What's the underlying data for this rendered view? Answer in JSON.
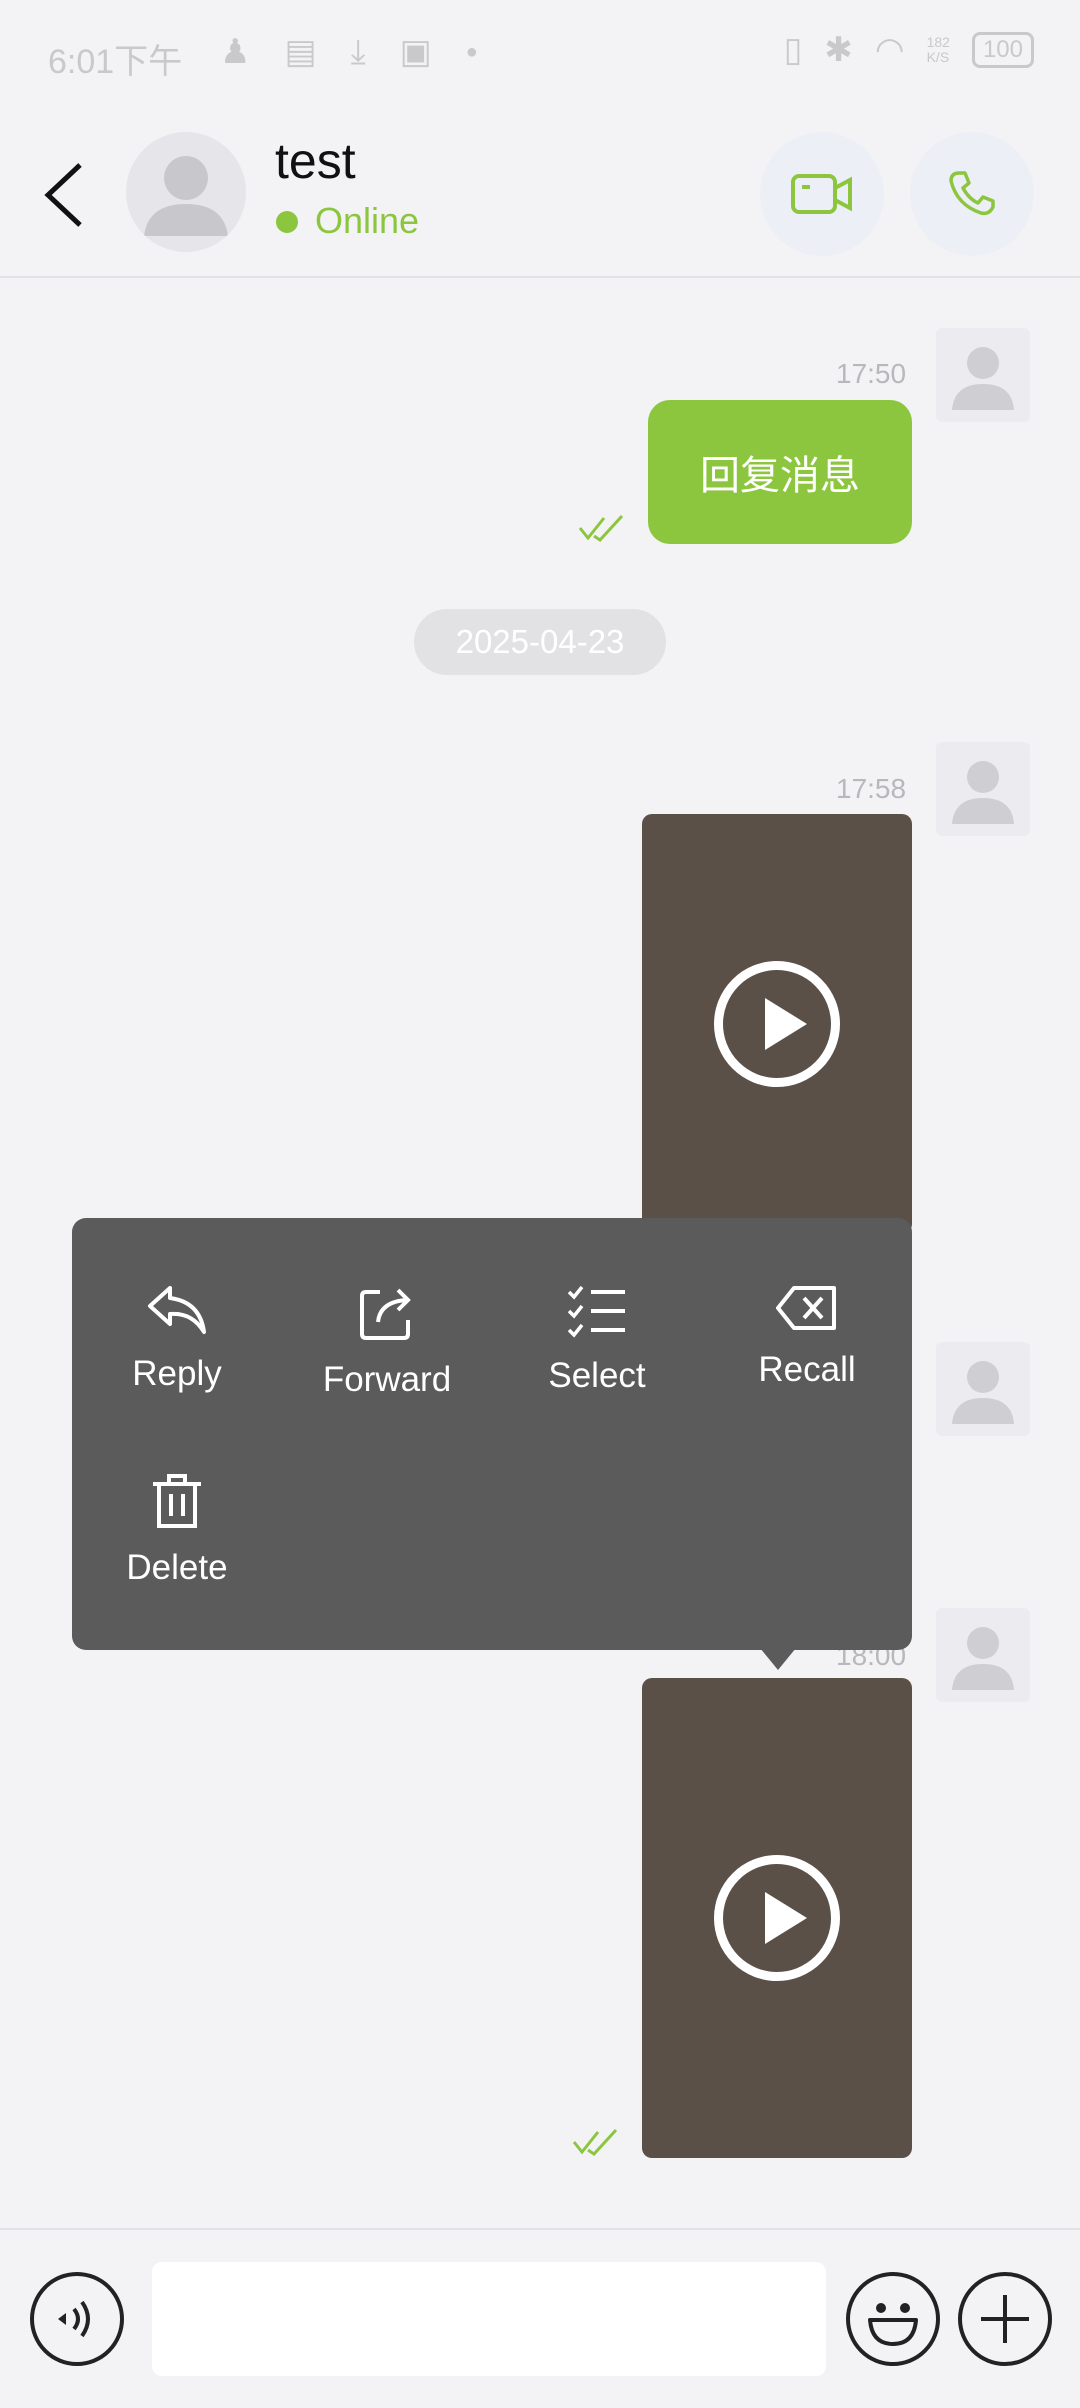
{
  "status_bar": {
    "time": "6:01下午",
    "net_speed": "182\nK/S",
    "battery": "100"
  },
  "header": {
    "title": "test",
    "status": "Online"
  },
  "messages": {
    "msg1": {
      "time": "17:50",
      "text": "回复消息"
    },
    "date_divider": "2025-04-23",
    "msg2": {
      "time": "17:58"
    },
    "msg3": {
      "time": "18:00"
    }
  },
  "context_menu": {
    "reply": "Reply",
    "forward": "Forward",
    "select": "Select",
    "recall": "Recall",
    "delete": "Delete"
  },
  "input": {
    "placeholder": ""
  },
  "colors": {
    "accent": "#8cc63f",
    "menu_bg": "#5b5b5b",
    "video_bg": "#5a5048"
  }
}
